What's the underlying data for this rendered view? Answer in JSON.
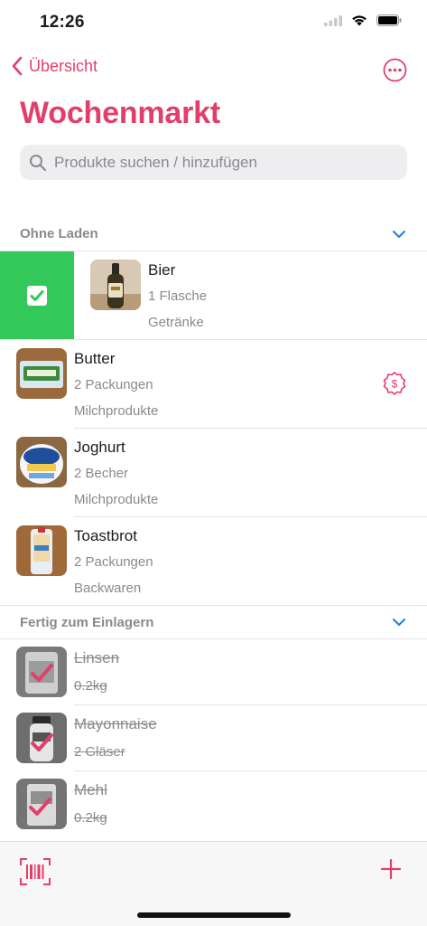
{
  "status_bar": {
    "time": "12:26"
  },
  "nav": {
    "back_label": "Übersicht"
  },
  "page": {
    "title": "Wochenmarkt"
  },
  "search": {
    "placeholder": "Produkte suchen / hinzufügen"
  },
  "colors": {
    "accent": "#e13f6b",
    "done_green": "#34c759",
    "link_blue": "#1a7fe0"
  },
  "sections": [
    {
      "title": "Ohne Laden",
      "items": [
        {
          "name": "Bier",
          "quantity": "1 Flasche",
          "category": "Getränke",
          "icon": "beer-bottle-photo"
        },
        {
          "name": "Butter",
          "quantity": "2 Packungen",
          "category": "Milchprodukte",
          "icon": "butter-photo"
        },
        {
          "name": "Joghurt",
          "quantity": "2 Becher",
          "category": "Milchprodukte",
          "icon": "yogurt-photo"
        },
        {
          "name": "Toastbrot",
          "quantity": "2 Packungen",
          "category": "Backwaren",
          "icon": "toast-bread-photo"
        }
      ]
    },
    {
      "title": "Fertig zum Einlagern",
      "items": [
        {
          "name": "Linsen",
          "quantity": "0.2kg",
          "icon": "lentils-photo"
        },
        {
          "name": "Mayonnaise",
          "quantity": "2 Gläser",
          "icon": "mayonnaise-photo"
        },
        {
          "name": "Mehl",
          "quantity": "0.2kg",
          "icon": "flour-photo"
        }
      ]
    }
  ]
}
